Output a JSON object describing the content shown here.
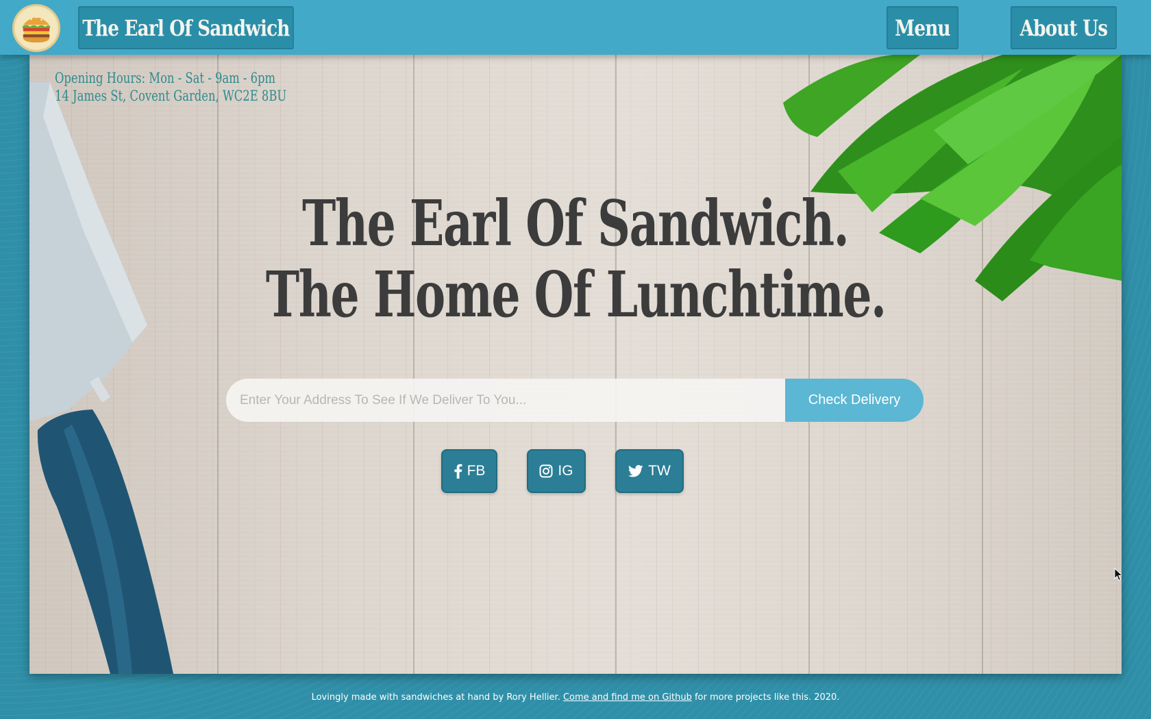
{
  "nav": {
    "brand": "The Earl Of Sandwich",
    "menu": "Menu",
    "about": "About Us",
    "logo_icon": "sandwich-logo-icon"
  },
  "hero": {
    "opening_hours": "Opening Hours: Mon - Sat - 9am - 6pm",
    "address": "14 James St, Covent Garden, WC2E 8BU",
    "headline_line1": "The Earl Of Sandwich.",
    "headline_line2": "The Home Of Lunchtime.",
    "search": {
      "placeholder": "Enter Your Address To See If We Deliver To You...",
      "value": "",
      "button": "Check Delivery"
    },
    "social": [
      {
        "label": "FB",
        "icon": "facebook-icon"
      },
      {
        "label": "IG",
        "icon": "instagram-icon"
      },
      {
        "label": "TW",
        "icon": "twitter-icon"
      }
    ]
  },
  "footer": {
    "text_before": "Lovingly made with sandwiches at hand by Rory Hellier.",
    "link": "Come and find me on Github",
    "text_after": "for more projects like this. 2020."
  },
  "colors": {
    "nav_bg": "#42a9c9",
    "button_bg": "#2b8ea8",
    "accent": "#5bb7d3",
    "headline": "#3c3c3c",
    "info_text": "#2f8a8c",
    "page_bg": "#2f8fa8"
  }
}
